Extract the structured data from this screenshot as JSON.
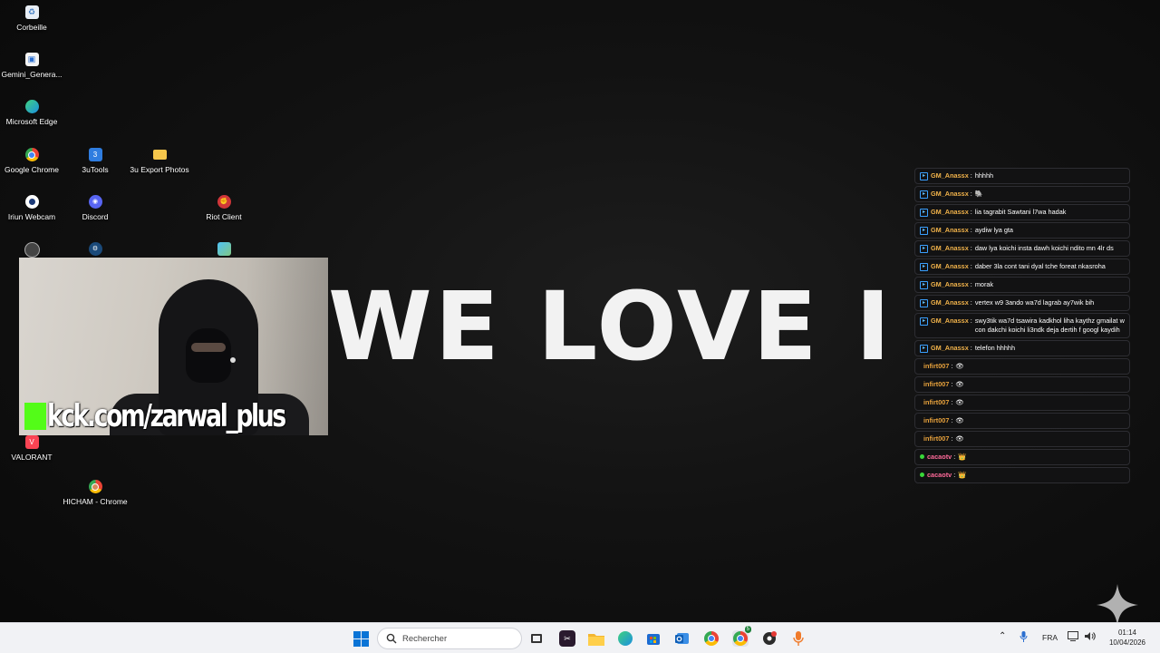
{
  "desktop": {
    "icons": {
      "corbeille": "Corbeille",
      "gemini": "Gemini_Genera...",
      "edge": "Microsoft Edge",
      "chrome": "Google Chrome",
      "tools3u": "3uTools",
      "export_photos": "3u Export Photos",
      "iriun": "Iriun Webcam",
      "discord": "Discord",
      "riot": "Riot Client",
      "valorant": "VALORANT",
      "hicham": "HICHAM - Chrome"
    }
  },
  "hero_text": "WE LOVE I",
  "webcam": {
    "overlay_text": "kck.com/zarwal_plus"
  },
  "chat": {
    "messages": [
      {
        "user": "GM_Anassx",
        "text": "hhhhh",
        "user_color": "#f0b24a",
        "badge": "blue"
      },
      {
        "user": "GM_Anassx",
        "text": "🐘",
        "user_color": "#f0b24a",
        "badge": "blue"
      },
      {
        "user": "GM_Anassx",
        "text": "lia tagrabit Sawtani l7wa hadak",
        "user_color": "#f0b24a",
        "badge": "blue"
      },
      {
        "user": "GM_Anassx",
        "text": "aydiw lya gta",
        "user_color": "#f0b24a",
        "badge": "blue"
      },
      {
        "user": "GM_Anassx",
        "text": "daw lya koichi insta dawh koichi ndito mn 4lr ds",
        "user_color": "#f0b24a",
        "badge": "blue"
      },
      {
        "user": "GM_Anassx",
        "text": "daber 3la cont tani dyal tche foreat nkasroha",
        "user_color": "#f0b24a",
        "badge": "blue"
      },
      {
        "user": "GM_Anassx",
        "text": "morak",
        "user_color": "#f0b24a",
        "badge": "blue"
      },
      {
        "user": "GM_Anassx",
        "text": "vertex w9 3ando wa7d lagrab ay7wik bih",
        "user_color": "#f0b24a",
        "badge": "blue"
      },
      {
        "user": "GM_Anassx",
        "text": "swy3tik wa7d tsawira kadkhol liha kaythz gmailat w con dakchi koichi li3ndk deja dertih f googl kaydih",
        "user_color": "#f0b24a",
        "badge": "blue"
      },
      {
        "user": "GM_Anassx",
        "text": "telefon hhhhh",
        "user_color": "#f0b24a",
        "badge": "blue"
      },
      {
        "user": "infirt007",
        "text": "👁",
        "user_color": "#e8a23c",
        "badge": "none"
      },
      {
        "user": "infirt007",
        "text": "👁",
        "user_color": "#e8a23c",
        "badge": "none"
      },
      {
        "user": "infirt007",
        "text": "👁",
        "user_color": "#e8a23c",
        "badge": "none"
      },
      {
        "user": "infirt007",
        "text": "👁",
        "user_color": "#e8a23c",
        "badge": "none"
      },
      {
        "user": "infirt007",
        "text": "👁",
        "user_color": "#e8a23c",
        "badge": "none"
      },
      {
        "user": "cacaotv",
        "text": "👑",
        "user_color": "#ff6a9a",
        "badge": "green"
      },
      {
        "user": "cacaotv",
        "text": "👑",
        "user_color": "#ff6a9a",
        "badge": "green"
      }
    ]
  },
  "taskbar": {
    "search_placeholder": "Rechercher",
    "lang": "FRA",
    "time": "01:14",
    "date": "10/04/2026",
    "chrome_badge": "5"
  },
  "colors": {
    "kick_green": "#53fc18",
    "windows_blue": "#0a74d6"
  }
}
